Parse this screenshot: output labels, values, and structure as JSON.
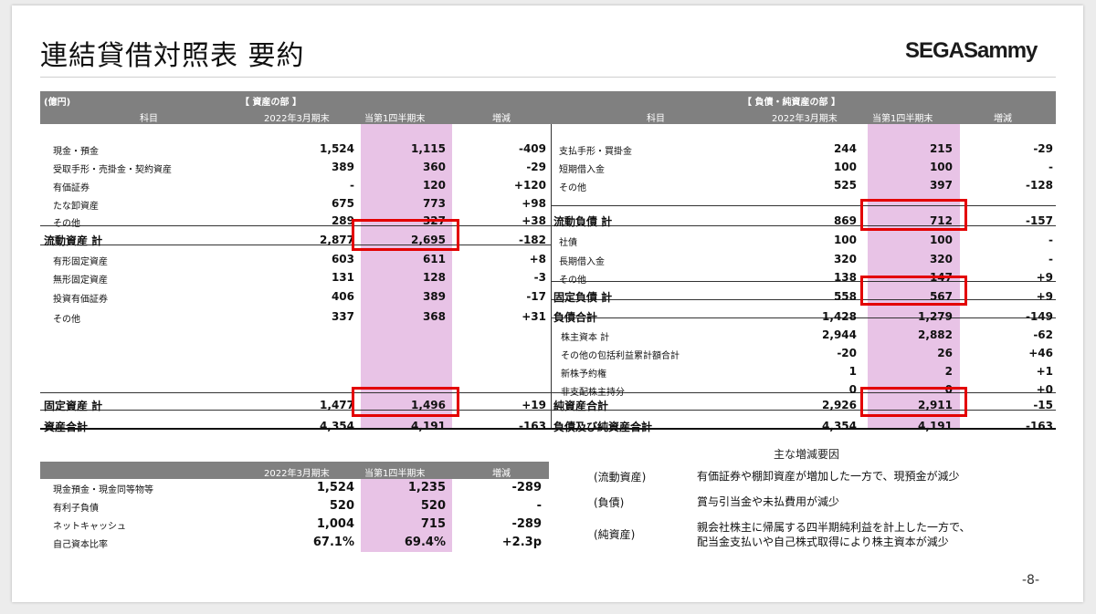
{
  "title": "連結貸借対照表 要約",
  "logo": "SEGASammy",
  "page_number": "-8-",
  "bs": {
    "unit": "(億円)",
    "assets_section": "【 資産の部 】",
    "liab_section": "【 負債・純資産の部 】",
    "col_item": "科目",
    "col_prev": "2022年3月期末",
    "col_curr": "当第1四半期末",
    "col_diff": "増減",
    "assets": [
      {
        "label": "現金・預金",
        "prev": "1,524",
        "curr": "1,115",
        "diff": "-409"
      },
      {
        "label": "受取手形・売掛金・契約資産",
        "prev": "389",
        "curr": "360",
        "diff": "-29"
      },
      {
        "label": "有価証券",
        "prev": "-",
        "curr": "120",
        "diff": "+120"
      },
      {
        "label": "たな卸資産",
        "prev": "675",
        "curr": "773",
        "diff": "+98"
      },
      {
        "label": "その他",
        "prev": "289",
        "curr": "327",
        "diff": "+38"
      },
      {
        "label": "流動資産 計",
        "prev": "2,877",
        "curr": "2,695",
        "diff": "-182"
      },
      {
        "label": "有形固定資産",
        "prev": "603",
        "curr": "611",
        "diff": "+8"
      },
      {
        "label": "無形固定資産",
        "prev": "131",
        "curr": "128",
        "diff": "-3"
      },
      {
        "label": "投資有価証券",
        "prev": "406",
        "curr": "389",
        "diff": "-17"
      },
      {
        "label": "その他",
        "prev": "337",
        "curr": "368",
        "diff": "+31"
      },
      {
        "label": "固定資産 計",
        "prev": "1,477",
        "curr": "1,496",
        "diff": "+19"
      },
      {
        "label": "資産合計",
        "prev": "4,354",
        "curr": "4,191",
        "diff": "-163"
      }
    ],
    "liabilities": [
      {
        "label": "支払手形・買掛金",
        "prev": "244",
        "curr": "215",
        "diff": "-29"
      },
      {
        "label": "短期借入金",
        "prev": "100",
        "curr": "100",
        "diff": "-"
      },
      {
        "label": "その他",
        "prev": "525",
        "curr": "397",
        "diff": "-128"
      },
      {
        "label": "流動負債 計",
        "prev": "869",
        "curr": "712",
        "diff": "-157"
      },
      {
        "label": "社債",
        "prev": "100",
        "curr": "100",
        "diff": "-"
      },
      {
        "label": "長期借入金",
        "prev": "320",
        "curr": "320",
        "diff": "-"
      },
      {
        "label": "その他",
        "prev": "138",
        "curr": "147",
        "diff": "+9"
      },
      {
        "label": "固定負債 計",
        "prev": "558",
        "curr": "567",
        "diff": "+9"
      },
      {
        "label": "負債合計",
        "prev": "1,428",
        "curr": "1,279",
        "diff": "-149"
      },
      {
        "label": "株主資本 計",
        "prev": "2,944",
        "curr": "2,882",
        "diff": "-62"
      },
      {
        "label": "その他の包括利益累計額合計",
        "prev": "-20",
        "curr": "26",
        "diff": "+46"
      },
      {
        "label": "新株予約権",
        "prev": "1",
        "curr": "2",
        "diff": "+1"
      },
      {
        "label": "非支配株主持分",
        "prev": "0",
        "curr": "0",
        "diff": "+0"
      },
      {
        "label": "純資産合計",
        "prev": "2,926",
        "curr": "2,911",
        "diff": "-15"
      },
      {
        "label": "負債及び純資産合計",
        "prev": "4,354",
        "curr": "4,191",
        "diff": "-163"
      }
    ]
  },
  "cash": {
    "col_prev": "2022年3月期末",
    "col_curr": "当第1四半期末",
    "col_diff": "増減",
    "rows": [
      {
        "label": "現金預金・現金同等物等",
        "prev": "1,524",
        "curr": "1,235",
        "diff": "-289"
      },
      {
        "label": "有利子負債",
        "prev": "520",
        "curr": "520",
        "diff": "-"
      },
      {
        "label": "ネットキャッシュ",
        "prev": "1,004",
        "curr": "715",
        "diff": "-289"
      },
      {
        "label": "自己資本比率",
        "prev": "67.1%",
        "curr": "69.4%",
        "diff": "+2.3p"
      }
    ]
  },
  "reasons": {
    "heading": "主な増減要因",
    "items": [
      {
        "category": "(流動資産)",
        "line1": "有価証券や棚卸資産が増加した一方で、現預金が減少",
        "line2": ""
      },
      {
        "category": "(負債)",
        "line1": "賞与引当金や未払費用が減少",
        "line2": ""
      },
      {
        "category": "(純資産)",
        "line1": "親会社株主に帰属する四半期純利益を計上した一方で、",
        "line2": "配当金支払いや自己株式取得により株主資本が減少"
      }
    ]
  }
}
